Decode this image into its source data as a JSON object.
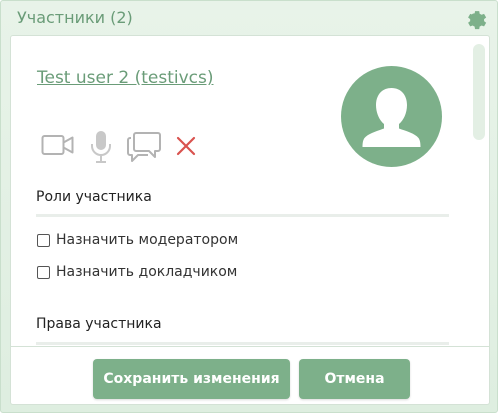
{
  "header": {
    "title": "Участники (2)",
    "settings_icon": "gear-icon"
  },
  "user": {
    "name_link": "Test user 2 (testivcs)",
    "avatar_icon": "user-silhouette-icon"
  },
  "actions": [
    {
      "icon": "video-camera-icon"
    },
    {
      "icon": "microphone-icon"
    },
    {
      "icon": "chat-bubbles-icon"
    },
    {
      "icon": "close-x-icon"
    }
  ],
  "roles": {
    "heading": "Роли участника",
    "options": [
      {
        "label": "Назначить модератором",
        "checked": false
      },
      {
        "label": "Назначить докладчиком",
        "checked": false
      }
    ]
  },
  "rights": {
    "heading": "Права участника"
  },
  "buttons": {
    "save": "Сохранить изменения",
    "cancel": "Отмена"
  },
  "colors": {
    "accent": "#7db08a",
    "link": "#6a9c78",
    "remove": "#d9534f",
    "icon_gray": "#b3b3b3"
  }
}
